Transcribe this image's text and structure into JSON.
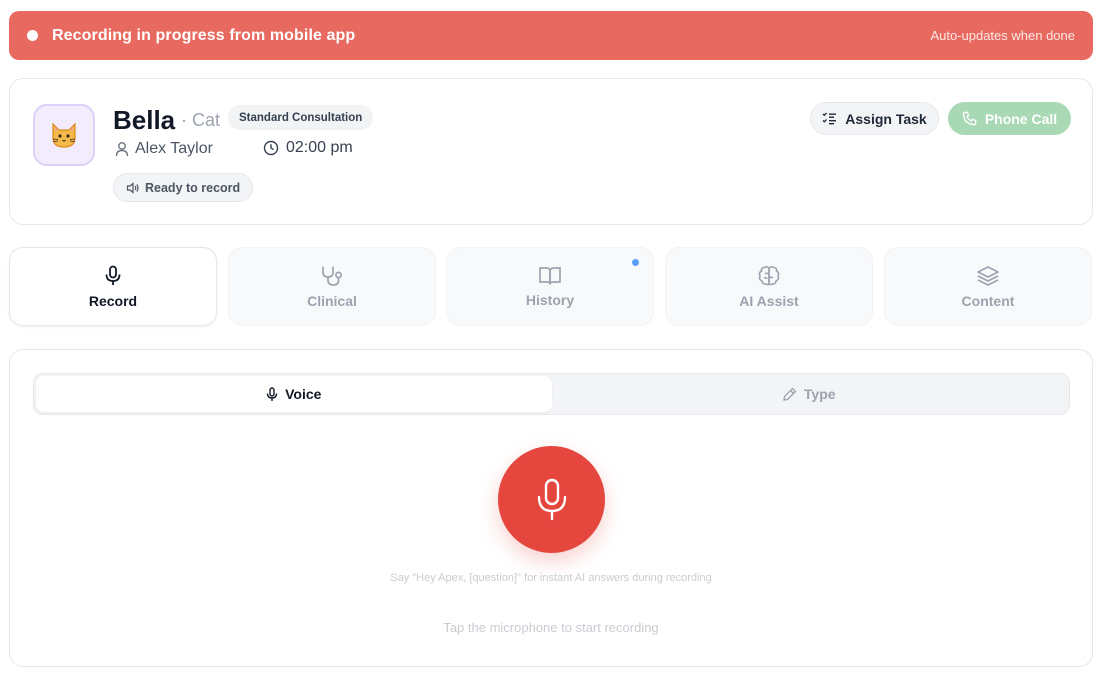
{
  "banner": {
    "message": "Recording in progress from mobile app",
    "subtext": "Auto-updates when done",
    "color": "#e8695f"
  },
  "patient": {
    "avatar_emoji": "🐱",
    "name": "Bella",
    "species": "· Cat",
    "consult_type": "Standard Consultation",
    "owner": "Alex Taylor",
    "time": "02:00 pm",
    "status": "Ready to record",
    "actions": {
      "assign_task": "Assign Task",
      "phone_call": "Phone Call"
    }
  },
  "tabs": [
    {
      "label": "Record",
      "icon": "mic-icon",
      "active": true
    },
    {
      "label": "Clinical",
      "icon": "stethoscope-icon",
      "active": false
    },
    {
      "label": "History",
      "icon": "book-icon",
      "active": false,
      "notification": true
    },
    {
      "label": "AI Assist",
      "icon": "brain-icon",
      "active": false
    },
    {
      "label": "Content",
      "icon": "layers-icon",
      "active": false
    }
  ],
  "recorder": {
    "modes": [
      {
        "label": "Voice",
        "icon": "mic-icon",
        "active": true
      },
      {
        "label": "Type",
        "icon": "pencil-icon",
        "active": false
      }
    ],
    "mic_color": "#e5473f",
    "hint_ai": "Say \"Hey Apex, [question]\" for instant AI answers during recording",
    "hint_start": "Tap the microphone to start recording"
  }
}
